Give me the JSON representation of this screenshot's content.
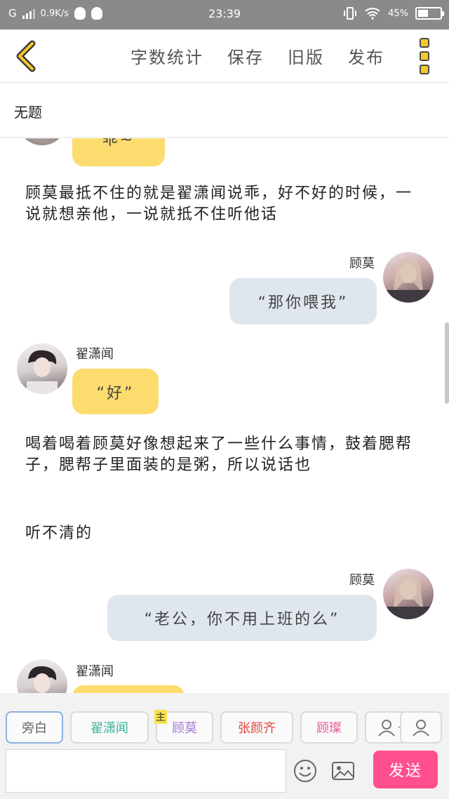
{
  "status": {
    "carrier": "G",
    "speed": "0.9K/s",
    "time": "23:39",
    "battery_text": "45%",
    "battery_level": 0.45
  },
  "nav": {
    "word_count": "字数统计",
    "save": "保存",
    "old_version": "旧版",
    "publish": "发布"
  },
  "title": "无题",
  "chat": {
    "top_bubble": "“乖~”",
    "narr1": "顾莫最抵不住的就是翟潇闻说乖，好不好的时候，一说就想亲他，一说就抵不住听他话",
    "m1_name": "顾莫",
    "m1_text": "“那你喂我”",
    "m2_name": "翟潇闻",
    "m2_text": "“好”",
    "narr2": "喝着喝着顾莫好像想起来了一些什么事情，鼓着腮帮子，腮帮子里面装的是粥，所以说话也",
    "narr3": "听不清的",
    "m3_name": "顾莫",
    "m3_text": "“老公，你不用上班的么”",
    "m4_name": "翟潇闻"
  },
  "roles": [
    {
      "label": "旁白",
      "color": "#666666"
    },
    {
      "label": "翟潇闻",
      "color": "#3bb3a0"
    },
    {
      "label": "顾莫",
      "color": "#a47ad6",
      "badge": "主"
    },
    {
      "label": "张颜齐",
      "color": "#e0463c"
    },
    {
      "label": "顾璨",
      "color": "#e85a9c"
    }
  ],
  "add_role_plus": "+",
  "send_label": "发送",
  "colors": {
    "accent": "#fcdc6e",
    "send": "#ff4f8e"
  }
}
